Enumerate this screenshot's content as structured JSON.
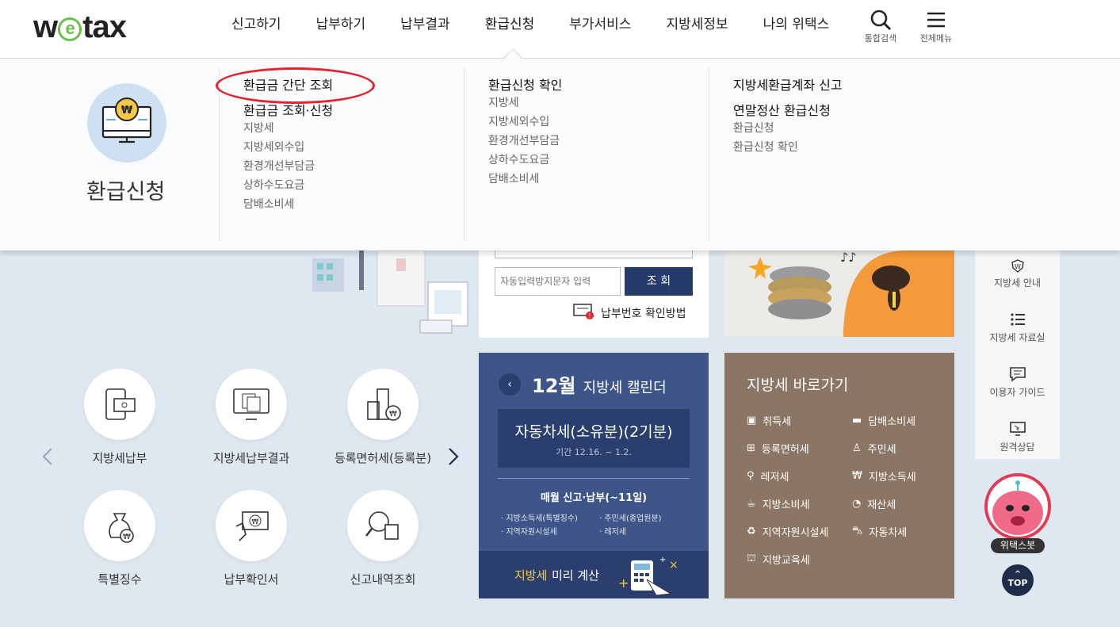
{
  "logo": {
    "prefix": "w",
    "e": "e",
    "suffix": "tax"
  },
  "gnb": [
    "신고하기",
    "납부하기",
    "납부결과",
    "환급신청",
    "부가서비스",
    "지방세정보",
    "나의 위택스"
  ],
  "util": {
    "search_label": "통합검색",
    "menu_label": "전체메뉴"
  },
  "mega": {
    "section_title": "환급신청",
    "col1": {
      "title1": "환급금 간단 조회",
      "title2": "환급금 조회·신청",
      "items": [
        "지방세",
        "지방세외수입",
        "환경개선부담금",
        "상하수도요금",
        "담배소비세"
      ]
    },
    "col2": {
      "title1": "환급신청 확인",
      "items": [
        "지방세",
        "지방세외수입",
        "환경개선부담금",
        "상하수도요금",
        "담배소비세"
      ]
    },
    "col3": {
      "title1": "지방세환급계좌 신고",
      "title2": "연말정산 환급신청",
      "items": [
        "환급신청",
        "환급신청 확인"
      ]
    }
  },
  "search": {
    "placeholder": "자동입력방지문자 입력",
    "button": "조 회",
    "help": "납부번호 확인방법"
  },
  "side": [
    "지방세 안내",
    "지방세 자료실",
    "이용자 가이드",
    "원격상담"
  ],
  "quick": [
    "지방세납부",
    "지방세납부결과",
    "등록면허세(등록분)",
    "특별징수",
    "납부확인서",
    "신고내역조회"
  ],
  "calendar": {
    "month": "12월",
    "title": "지방세 캘린더",
    "tax_name": "자동차세(소유분)(2기분)",
    "period": "기간 12.16. ~ 1.2.",
    "monthly": "매월 신고·납부(~11일)",
    "items": [
      "지방소득세(특별징수)",
      "주민세(종업원분)",
      "지역자원시설세",
      "레저세"
    ],
    "calc_text1": "지방세",
    "calc_text2": " 미리 계산"
  },
  "shortcut": {
    "title": "지방세 바로가기",
    "items": [
      "취득세",
      "담배소비세",
      "등록면허세",
      "주민세",
      "레저세",
      "지방소득세",
      "지방소비세",
      "재산세",
      "지역자원시설세",
      "자동차세",
      "지방교육세"
    ]
  },
  "bot_label": "위택스봇",
  "top_label": "TOP"
}
